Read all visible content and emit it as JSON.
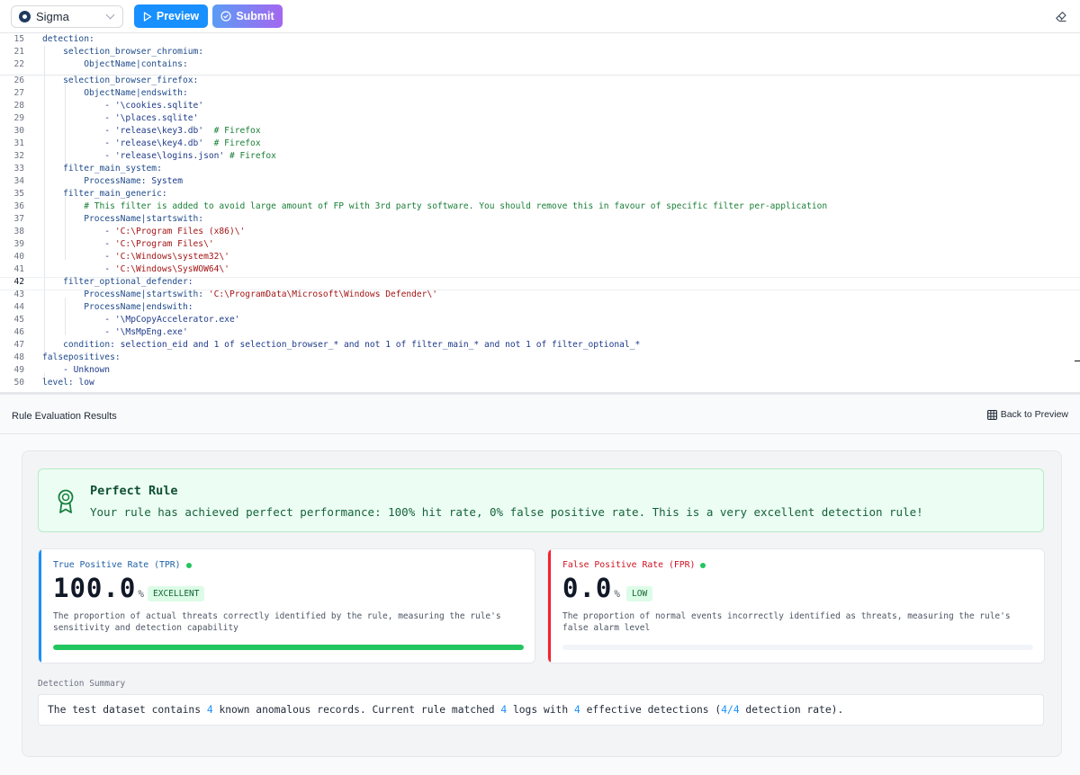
{
  "toolbar": {
    "language": "Sigma",
    "preview_label": "Preview",
    "submit_label": "Submit"
  },
  "editor": {
    "lines": [
      {
        "n": "15",
        "segs": [
          [
            "k",
            "detection"
          ],
          [
            "p",
            ":"
          ]
        ]
      },
      {
        "n": "21",
        "segs": [
          [
            "p",
            "    "
          ],
          [
            "k",
            "selection_browser_chromium"
          ],
          [
            "p",
            ":"
          ]
        ]
      },
      {
        "n": "22",
        "segs": [
          [
            "p",
            "        "
          ],
          [
            "k",
            "ObjectName|contains"
          ],
          [
            "p",
            ":"
          ]
        ]
      },
      {
        "n": "26",
        "segs": [
          [
            "p",
            "    "
          ],
          [
            "k",
            "selection_browser_firefox"
          ],
          [
            "p",
            ":"
          ]
        ]
      },
      {
        "n": "27",
        "segs": [
          [
            "p",
            "        "
          ],
          [
            "k",
            "ObjectName|endswith"
          ],
          [
            "p",
            ":"
          ]
        ]
      },
      {
        "n": "28",
        "segs": [
          [
            "p",
            "            - "
          ],
          [
            "p",
            "'\\cookies.sqlite'"
          ]
        ]
      },
      {
        "n": "29",
        "segs": [
          [
            "p",
            "            - "
          ],
          [
            "p",
            "'\\places.sqlite'"
          ]
        ]
      },
      {
        "n": "30",
        "segs": [
          [
            "p",
            "            - "
          ],
          [
            "p",
            "'release\\key3.db'  "
          ],
          [
            "c",
            "# Firefox"
          ]
        ]
      },
      {
        "n": "31",
        "segs": [
          [
            "p",
            "            - "
          ],
          [
            "p",
            "'release\\key4.db'  "
          ],
          [
            "c",
            "# Firefox"
          ]
        ]
      },
      {
        "n": "32",
        "segs": [
          [
            "p",
            "            - "
          ],
          [
            "p",
            "'release\\logins.json' "
          ],
          [
            "c",
            "# Firefox"
          ]
        ]
      },
      {
        "n": "33",
        "segs": [
          [
            "p",
            "    "
          ],
          [
            "k",
            "filter_main_system"
          ],
          [
            "p",
            ":"
          ]
        ]
      },
      {
        "n": "34",
        "segs": [
          [
            "p",
            "        "
          ],
          [
            "k",
            "ProcessName"
          ],
          [
            "p",
            ": System"
          ]
        ]
      },
      {
        "n": "35",
        "segs": [
          [
            "p",
            "    "
          ],
          [
            "k",
            "filter_main_generic"
          ],
          [
            "p",
            ":"
          ]
        ]
      },
      {
        "n": "36",
        "segs": [
          [
            "p",
            "        "
          ],
          [
            "c",
            "# This filter is added to avoid large amount of FP with 3rd party software. You should remove this in favour of specific filter per-application"
          ]
        ]
      },
      {
        "n": "37",
        "segs": [
          [
            "p",
            "        "
          ],
          [
            "k",
            "ProcessName|startswith"
          ],
          [
            "p",
            ":"
          ]
        ]
      },
      {
        "n": "38",
        "segs": [
          [
            "p",
            "            - "
          ],
          [
            "s",
            "'C:\\Program Files (x86)\\'"
          ]
        ]
      },
      {
        "n": "39",
        "segs": [
          [
            "p",
            "            - "
          ],
          [
            "s",
            "'C:\\Program Files\\'"
          ]
        ]
      },
      {
        "n": "40",
        "segs": [
          [
            "p",
            "            - "
          ],
          [
            "s",
            "'C:\\Windows\\system32\\'"
          ]
        ]
      },
      {
        "n": "41",
        "segs": [
          [
            "p",
            "            - "
          ],
          [
            "s",
            "'C:\\Windows\\SysWOW64\\'"
          ]
        ]
      },
      {
        "n": "42",
        "segs": [
          [
            "p",
            "    "
          ],
          [
            "k",
            "filter_optional_defender"
          ],
          [
            "p",
            ":"
          ]
        ]
      },
      {
        "n": "43",
        "segs": [
          [
            "p",
            "        "
          ],
          [
            "k",
            "ProcessName|startswith"
          ],
          [
            "p",
            ": "
          ],
          [
            "s",
            "'C:\\ProgramData\\Microsoft\\Windows Defender\\'"
          ]
        ]
      },
      {
        "n": "44",
        "segs": [
          [
            "p",
            "        "
          ],
          [
            "k",
            "ProcessName|endswith"
          ],
          [
            "p",
            ":"
          ]
        ]
      },
      {
        "n": "45",
        "segs": [
          [
            "p",
            "            - "
          ],
          [
            "p",
            "'\\MpCopyAccelerator.exe'"
          ]
        ]
      },
      {
        "n": "46",
        "segs": [
          [
            "p",
            "            - "
          ],
          [
            "p",
            "'\\MsMpEng.exe'"
          ]
        ]
      },
      {
        "n": "47",
        "segs": [
          [
            "p",
            "    "
          ],
          [
            "k",
            "condition"
          ],
          [
            "p",
            ": selection_eid and 1 of selection_browser_* and not 1 of filter_main_* and not 1 of filter_optional_*"
          ]
        ]
      },
      {
        "n": "48",
        "segs": [
          [
            "k",
            "falsepositives"
          ],
          [
            "p",
            ":"
          ]
        ]
      },
      {
        "n": "49",
        "segs": [
          [
            "p",
            "    - Unknown"
          ]
        ]
      },
      {
        "n": "50",
        "segs": [
          [
            "k",
            "level"
          ],
          [
            "p",
            ": low"
          ]
        ]
      }
    ]
  },
  "results": {
    "title": "Rule Evaluation Results",
    "back_label": "Back to Preview",
    "perfect": {
      "title": "Perfect Rule",
      "message": "Your rule has achieved perfect performance: 100% hit rate, 0% false positive rate. This is a very excellent detection rule!"
    },
    "tpr": {
      "label": "True Positive Rate (TPR)",
      "value": "100.0",
      "unit": "%",
      "badge": "EXCELLENT",
      "description": "The proportion of actual threats correctly identified by the rule, measuring the rule's sensitivity and detection capability",
      "progress": 100
    },
    "fpr": {
      "label": "False Positive Rate (FPR)",
      "value": "0.0",
      "unit": "%",
      "badge": "LOW",
      "description": "The proportion of normal events incorrectly identified as threats, measuring the rule's false alarm level",
      "progress": 0
    },
    "summary": {
      "label": "Detection Summary",
      "t1": "The test dataset contains ",
      "n1": "4",
      "t2": " known anomalous records. Current rule matched ",
      "n2": "4",
      "t3": " logs with ",
      "n3": "4",
      "t4": " effective detections (",
      "n4": "4/4",
      "t5": " detection rate)."
    }
  },
  "colors": {
    "primary": "#1890ff",
    "success": "#22c55e",
    "danger": "#f5222d"
  }
}
